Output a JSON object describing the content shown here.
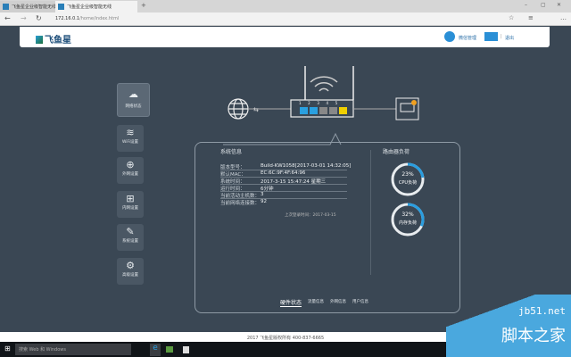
{
  "browser": {
    "tabs": [
      "飞鱼星企业级智能无线上网",
      "飞鱼星企业级智能无线"
    ],
    "new_tab": "+",
    "url_host": "172.16.0.1",
    "url_path": "/home/index.html",
    "window_controls": [
      "–",
      "▢",
      "✕"
    ]
  },
  "header": {
    "logo": "飞鱼星",
    "wechat": "微信管理",
    "logout": "退出",
    "sep": "|"
  },
  "sidebar": [
    {
      "label": "网络状态",
      "icon": "cloud-icon"
    },
    {
      "label": "WiFi设置",
      "icon": "wifi-icon"
    },
    {
      "label": "外网设置",
      "icon": "globe-icon"
    },
    {
      "label": "内网设置",
      "icon": "lan-icon"
    },
    {
      "label": "系统设置",
      "icon": "wrench-icon"
    },
    {
      "label": "高级设置",
      "icon": "gear-icon"
    }
  ],
  "topology": {
    "ports": [
      "1",
      "2",
      "3",
      "4",
      "5"
    ]
  },
  "system": {
    "title": "系统信息",
    "rows": [
      {
        "k": "版本型号：",
        "v": "Build-KW1058[2017-03-01 14:32:05]"
      },
      {
        "k": "默认MAC：",
        "v": "EC:6C:9F:4F:64:96"
      },
      {
        "k": "系统时间：",
        "v": "2017-3-15 15:47:24 星期三"
      },
      {
        "k": "运行时间：",
        "v": "6分钟"
      },
      {
        "k": "当前活动主机数：",
        "v": "3"
      },
      {
        "k": "当前网络连接数：",
        "v": "92"
      }
    ],
    "last_login": "上次登录时间：2017-03-15"
  },
  "load": {
    "title": "路由器负荷",
    "cpu": {
      "pct": "23%",
      "label": "CPU负荷",
      "value": 23
    },
    "mem": {
      "pct": "32%",
      "label": "内存负荷",
      "value": 32
    }
  },
  "panel_tabs": [
    "硬件状态",
    "流量信息",
    "外网信息",
    "用户信息"
  ],
  "footer": "2017 飞鱼星版权所有    400-837-6665",
  "taskbar": {
    "search": "搜索 Web 和 Windows"
  },
  "watermark": {
    "site": "jb51.net",
    "name": "脚本之家"
  }
}
